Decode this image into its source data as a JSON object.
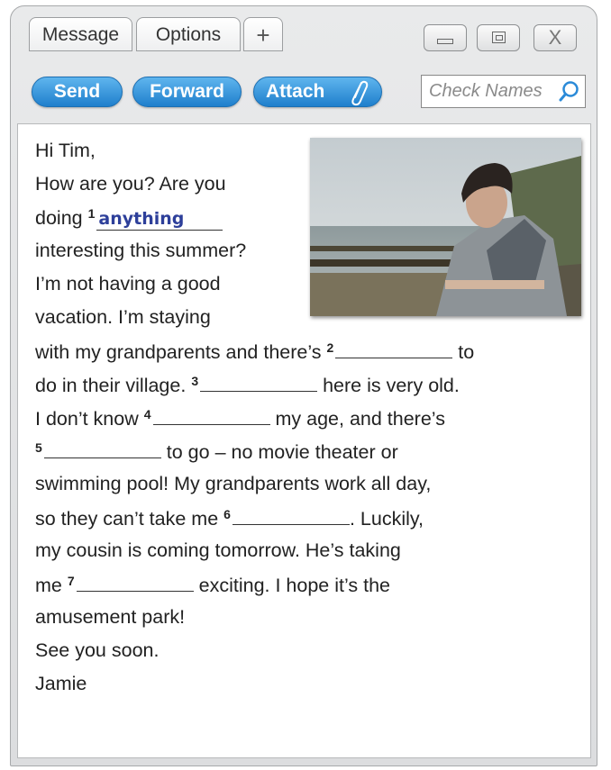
{
  "tabs": {
    "message": "Message",
    "options": "Options",
    "add": "+"
  },
  "window_controls": {
    "close_glyph": "X"
  },
  "toolbar": {
    "send": "Send",
    "forward": "Forward",
    "attach": "Attach"
  },
  "search": {
    "placeholder": "Check Names"
  },
  "email": {
    "greeting": "Hi Tim,",
    "line2": "How are you? Are you",
    "line3_pre": "doing",
    "num1": "1",
    "answer1": "anything",
    "line4": "interesting this summer?",
    "line5": "I’m not having a good",
    "line6": "vacation. I’m staying",
    "line7_pre": "with my grandparents and there’s",
    "num2": "2",
    "line7_post": "to",
    "line8_pre": "do in their village.",
    "num3": "3",
    "line8_post": "here is very old.",
    "line9_pre": "I don’t know",
    "num4": "4",
    "line9_post": "my age, and there’s",
    "num5": "5",
    "line10_post": "to go – no movie theater or",
    "line11": "swimming pool! My grandparents work all day,",
    "line12_pre": "so they can’t take me",
    "num6": "6",
    "line12_post": ". Luckily,",
    "line13": "my cousin is coming tomorrow. He’s taking",
    "line14_pre": "me",
    "num7": "7",
    "line14_post": "exciting. I hope it’s the",
    "line15": "amusement park!",
    "line16": "See you soon.",
    "signature": "Jamie"
  },
  "colors": {
    "accent": "#2a8ad8",
    "answer": "#2d3f9a"
  },
  "icons": {
    "search": "magnifier-icon",
    "attach": "paperclip-icon"
  }
}
